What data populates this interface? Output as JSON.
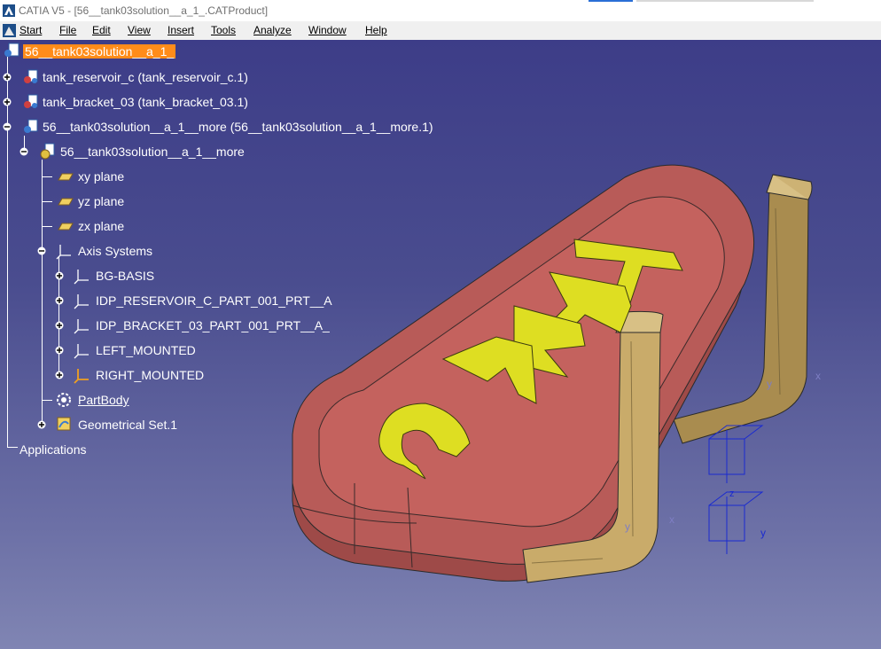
{
  "window": {
    "title": "CATIA V5 - [56__tank03solution__a_1_.CATProduct]"
  },
  "menu": [
    "Start",
    "File",
    "Edit",
    "View",
    "Insert",
    "Tools",
    "Analyze",
    "Window",
    "Help"
  ],
  "tree": {
    "root": "56__tank03solution__a_1_",
    "children": [
      "tank_reservoir_c (tank_reservoir_c.1)",
      "tank_bracket_03 (tank_bracket_03.1)",
      "56__tank03solution__a_1__more (56__tank03solution__a_1__more.1)"
    ],
    "part": "56__tank03solution__a_1__more",
    "planes": [
      "xy plane",
      "yz plane",
      "zx plane"
    ],
    "axis_systems_label": "Axis Systems",
    "axis_systems": [
      "BG-BASIS",
      "IDP_RESERVOIR_C_PART_001_PRT__A",
      "IDP_BRACKET_03_PART_001_PRT__A_",
      "LEFT_MOUNTED",
      "RIGHT_MOUNTED"
    ],
    "part_body": "PartBody",
    "geometrical_set": "Geometrical Set.1",
    "applications": "Applications"
  },
  "model": {
    "embossed_text": "TANK C",
    "tank_color": "#b85b58",
    "bracket_color": "#c9ab6a",
    "letter_color": "#dede22"
  },
  "axis_labels": {
    "x": "x",
    "y": "y",
    "z": "z"
  }
}
